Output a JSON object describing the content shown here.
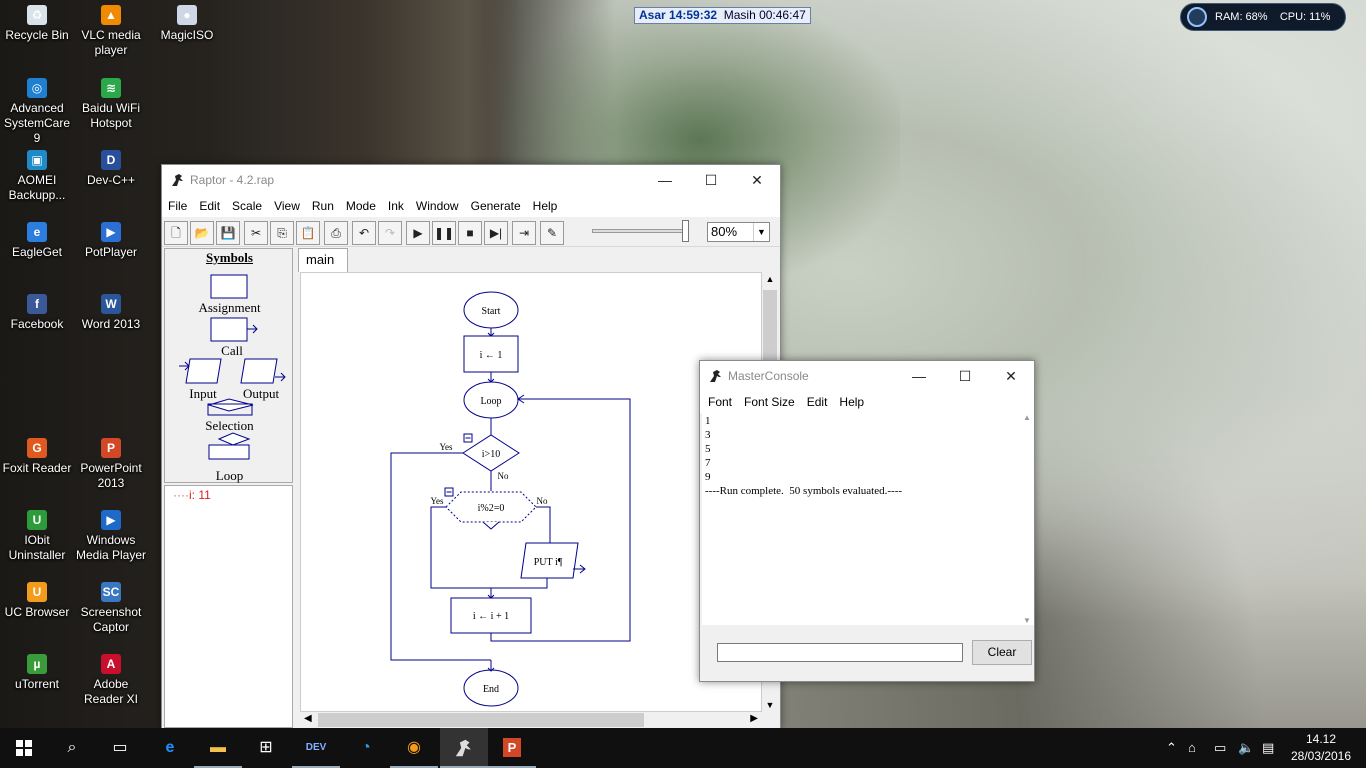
{
  "desktop": {
    "icons": [
      {
        "label": "Recycle Bin",
        "color": "#d9e3ea",
        "glyph": "♻"
      },
      {
        "label": "VLC media player",
        "color": "#f08a00",
        "glyph": "▲"
      },
      {
        "label": "MagicISO",
        "color": "#cfd6e6",
        "glyph": "●"
      },
      {
        "label": "Advanced SystemCare 9",
        "color": "#1f7fd1",
        "glyph": "◎"
      },
      {
        "label": "Baidu WiFi Hotspot",
        "color": "#2aa84a",
        "glyph": "≋"
      },
      {
        "label": "AOMEI Backupp...",
        "color": "#1f8ac8",
        "glyph": "▣"
      },
      {
        "label": "Dev-C++",
        "color": "#2a4f9a",
        "glyph": "D"
      },
      {
        "label": "EagleGet",
        "color": "#2b7de0",
        "glyph": "e"
      },
      {
        "label": "PotPlayer",
        "color": "#2b6fd4",
        "glyph": "▶"
      },
      {
        "label": "Facebook",
        "color": "#3b5998",
        "glyph": "f"
      },
      {
        "label": "Word 2013",
        "color": "#2b579a",
        "glyph": "W"
      },
      {
        "label": "Foxit Reader",
        "color": "#e05a20",
        "glyph": "G"
      },
      {
        "label": "PowerPoint 2013",
        "color": "#d24726",
        "glyph": "P"
      },
      {
        "label": "IObit Uninstaller",
        "color": "#2d9b3a",
        "glyph": "U"
      },
      {
        "label": "Windows Media Player",
        "color": "#1e6ac8",
        "glyph": "▶"
      },
      {
        "label": "UC Browser",
        "color": "#f29b1d",
        "glyph": "U"
      },
      {
        "label": "Screenshot Captor",
        "color": "#3a77c2",
        "glyph": "SC"
      },
      {
        "label": "uTorrent",
        "color": "#3a9b3a",
        "glyph": "µ"
      },
      {
        "label": "Adobe Reader XI",
        "color": "#c8102e",
        "glyph": "A"
      }
    ]
  },
  "clock_bar": {
    "prayer": "Asar 14:59:32",
    "remaining": "Masih 00:46:47"
  },
  "sysmon": {
    "ram": "RAM: 68%",
    "cpu": "CPU: 11%"
  },
  "raptor": {
    "title": "Raptor - 4.2.rap",
    "menu": [
      "File",
      "Edit",
      "Scale",
      "View",
      "Run",
      "Mode",
      "Ink",
      "Window",
      "Generate",
      "Help"
    ],
    "zoom": "80%",
    "symbols": {
      "header": "Symbols",
      "assignment": "Assignment",
      "call": "Call",
      "input": "Input",
      "output": "Output",
      "selection": "Selection",
      "loop": "Loop"
    },
    "variable": "i: 11",
    "tab": "main",
    "flowchart": {
      "start": "Start",
      "init": "i ← 1",
      "loop": "Loop",
      "cond": "i>10",
      "yes1": "Yes",
      "no1": "No",
      "mod": "i%2=0",
      "yes2": "Yes",
      "no2": "No",
      "put": "PUT i¶",
      "inc": "i ← i + 1",
      "end": "End"
    }
  },
  "console": {
    "title": "MasterConsole",
    "menu": [
      "Font",
      "Font Size",
      "Edit",
      "Help"
    ],
    "lines": [
      "1",
      "3",
      "5",
      "7",
      "9",
      "----Run complete.  50 symbols evaluated.----"
    ],
    "clear": "Clear"
  },
  "taskbar": {
    "time": "14.12",
    "date": "28/03/2016"
  }
}
